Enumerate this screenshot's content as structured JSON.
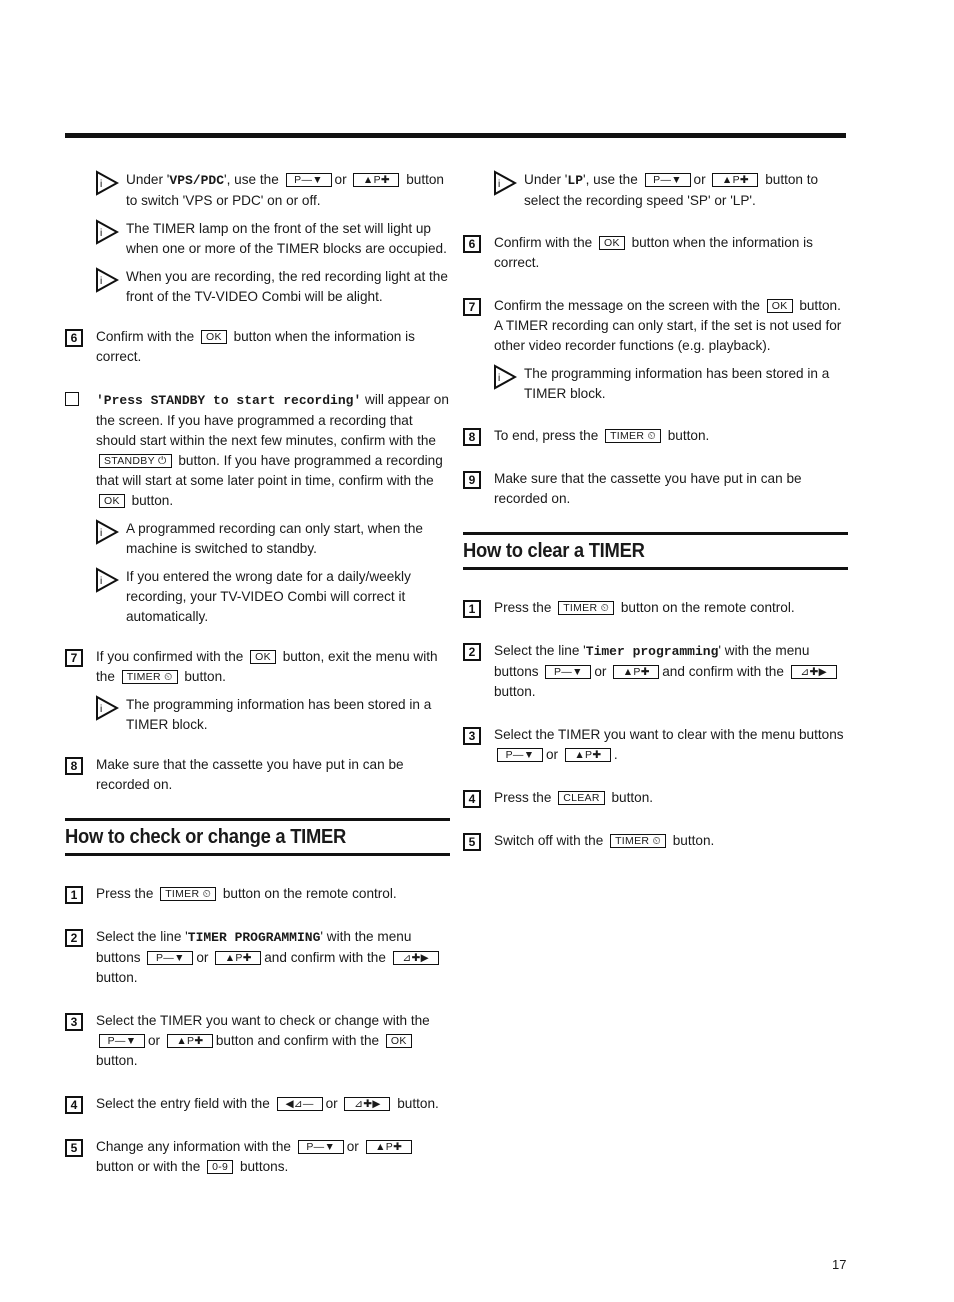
{
  "page": {
    "number": "17"
  },
  "icons": {
    "tip": "info-triangle-icon",
    "step_box": "numbered-square-icon",
    "checkbox": "empty-square-icon",
    "timer": "clock-icon",
    "standby": "power-icon"
  },
  "keys": {
    "p_minus": "P—▼",
    "p_plus": "▲P✚",
    "ok": "OK",
    "timer": "TIMER ⏲",
    "standby": "STANDBY ⏻",
    "vol_plus_right": "⊿✚▶",
    "left_vol_minus": "◀⊿—",
    "zero_nine": "0-9",
    "clear": "CLEAR"
  },
  "left": {
    "notes_top": [
      {
        "pre": "Under '",
        "mono": "VPS/PDC",
        "post1": "', use the",
        "or": "or",
        "post2": "button to switch 'VPS or PDC' on or off."
      },
      {
        "text": "The TIMER lamp on the front of the set will light up when one or more of the TIMER blocks are occupied."
      },
      {
        "text": "When you are recording, the red recording light at the front of the TV-VIDEO Combi will be alight."
      }
    ],
    "step6": {
      "num": "6",
      "pre": "Confirm with the",
      "post": "button when the information is correct."
    },
    "checkbox_step": {
      "mono": "'Press STANDBY to start recording'",
      "t1": " will appear on the screen. If you have programmed a recording that should start within the next few minutes, confirm with the",
      "t2": "button. If you have programmed a recording that will start at some later point in time, confirm with the",
      "t3": "button."
    },
    "notes_mid": [
      {
        "text": "A programmed recording can only start, when the machine is switched to standby."
      },
      {
        "text": "If you entered the wrong date for a daily/weekly recording, your TV-VIDEO Combi will correct it automatically."
      }
    ],
    "step7": {
      "num": "7",
      "pre": "If you confirmed with the",
      "mid": "button, exit the menu with the",
      "post": "button."
    },
    "note_stored": "The programming information has been stored in a TIMER block.",
    "step8": {
      "num": "8",
      "text": "Make sure that the cassette you have put in can be recorded on."
    },
    "section_check": {
      "title": "How to check or change a TIMER",
      "steps": [
        {
          "num": "1",
          "pre": "Press the",
          "post": "button on the remote control."
        },
        {
          "num": "2",
          "pre": "Select the line '",
          "mono": "TIMER PROGRAMMING",
          "mid1": "' with the menu buttons",
          "or": "or",
          "mid2": "and confirm with the",
          "post": "button."
        },
        {
          "num": "3",
          "pre": "Select the TIMER you want to check or change with the",
          "or": "or",
          "mid": "button and confirm with the",
          "post": "button."
        },
        {
          "num": "4",
          "pre": "Select the entry field with the",
          "or": "or",
          "post": "button."
        },
        {
          "num": "5",
          "pre": "Change any information with the",
          "or": "or",
          "mid": "button or with the",
          "post": "buttons."
        }
      ]
    }
  },
  "right": {
    "note_lp": {
      "pre": "Under '",
      "mono": "LP",
      "post1": "', use the",
      "or": "or",
      "post2": "button to select the recording speed 'SP' or 'LP'."
    },
    "step6": {
      "num": "6",
      "pre": "Confirm with the",
      "post": "button when the information is correct."
    },
    "step7": {
      "num": "7",
      "pre": "Confirm the message on the screen with the",
      "post": "button. A TIMER recording can only start, if the set is not used for other video recorder functions (e.g. playback)."
    },
    "note_stored": "The programming information has been stored in a TIMER block.",
    "step8": {
      "num": "8",
      "pre": "To end, press the",
      "post": "button."
    },
    "step9": {
      "num": "9",
      "text": "Make sure that the cassette you have put in can be recorded on."
    },
    "section_clear": {
      "title": "How to clear a TIMER",
      "steps": [
        {
          "num": "1",
          "pre": "Press the",
          "post": "button on the remote control."
        },
        {
          "num": "2",
          "pre": "Select the line '",
          "mono": "Timer programming",
          "mid1": "' with the menu buttons",
          "or": "or",
          "mid2": "and confirm with the",
          "post": "button."
        },
        {
          "num": "3",
          "pre": "Select the TIMER you want to clear with the menu buttons",
          "or": "or",
          "post": "."
        },
        {
          "num": "4",
          "pre": "Press the",
          "post": "button."
        },
        {
          "num": "5",
          "pre": "Switch off with the",
          "post": "button."
        }
      ]
    }
  }
}
